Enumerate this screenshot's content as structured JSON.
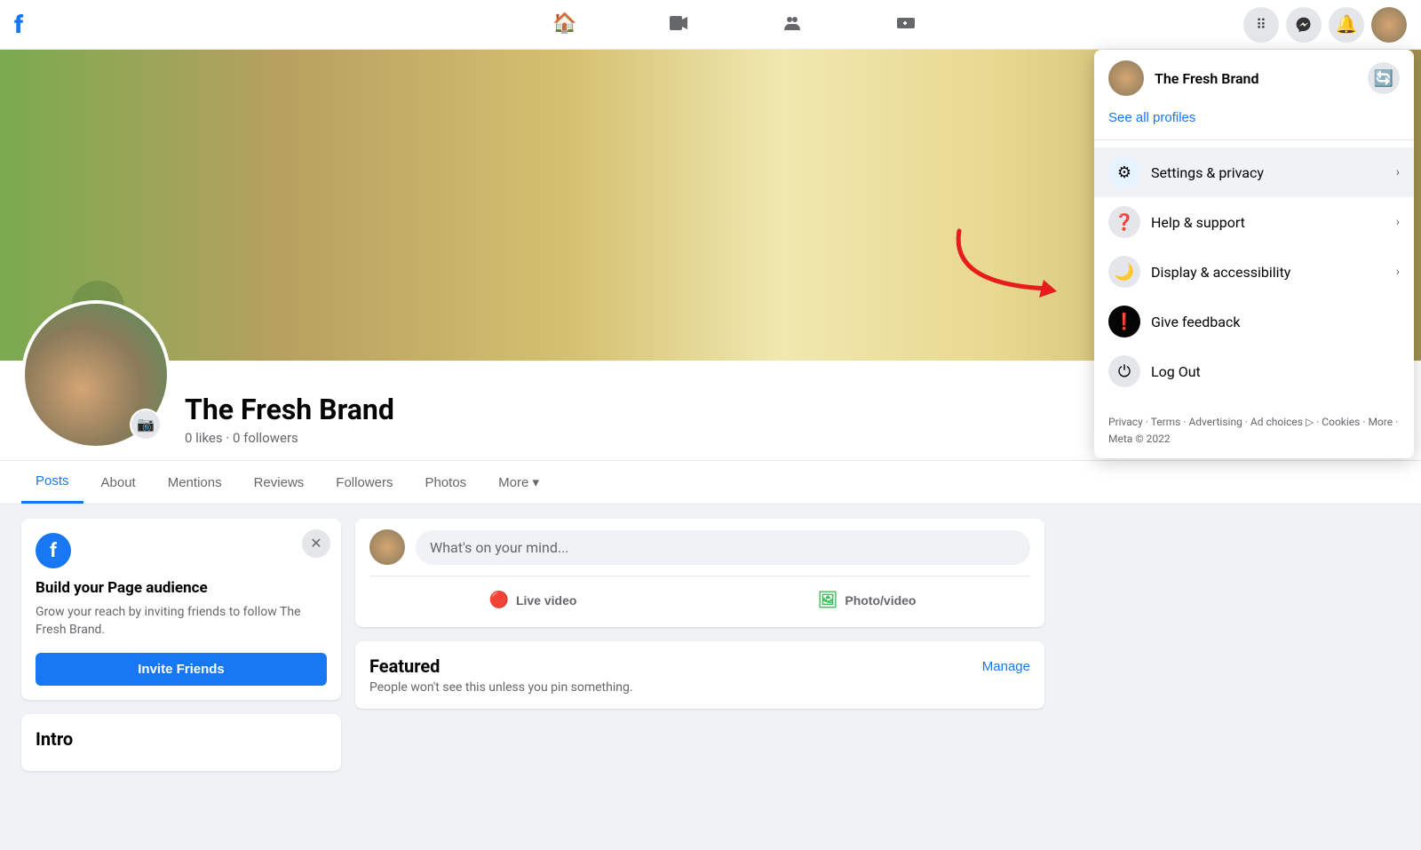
{
  "topnav": {
    "icons": {
      "home": "🏠",
      "video": "▶",
      "groups": "👥",
      "gaming": "🖥",
      "apps": "⠿",
      "messenger": "💬",
      "notifications": "🔔"
    }
  },
  "profile": {
    "name": "The Fresh Brand",
    "likes": "0 likes",
    "followers": "0 followers",
    "stats": "0 likes · 0 followers",
    "avatar_alt": "The Fresh Brand profile picture"
  },
  "tabs": {
    "items": [
      {
        "label": "Posts",
        "active": true
      },
      {
        "label": "About"
      },
      {
        "label": "Mentions"
      },
      {
        "label": "Reviews"
      },
      {
        "label": "Followers"
      },
      {
        "label": "Photos"
      },
      {
        "label": "More ▾"
      }
    ]
  },
  "build_audience_card": {
    "title": "Build your Page audience",
    "description": "Grow your reach by inviting friends to follow The Fresh Brand.",
    "button_label": "Invite Friends"
  },
  "intro": {
    "title": "Intro"
  },
  "post_box": {
    "placeholder": "What's on your mind...",
    "live_label": "Live video",
    "photo_label": "Photo/video"
  },
  "featured_section": {
    "title": "Featured",
    "description": "People won't see this unless you pin something.",
    "manage_label": "Manage"
  },
  "dropdown_menu": {
    "profile_name": "The Fresh Brand",
    "see_all_profiles": "See all profiles",
    "items": [
      {
        "icon": "⚙",
        "label": "Settings & privacy",
        "highlighted": true
      },
      {
        "icon": "❓",
        "label": "Help & support"
      },
      {
        "icon": "🌙",
        "label": "Display & accessibility"
      },
      {
        "icon": "❗",
        "label": "Give feedback"
      },
      {
        "icon": "⏻",
        "label": "Log Out"
      }
    ],
    "footer": "Privacy · Terms · Advertising · Ad choices ▷ · Cookies · More · Meta © 2022"
  }
}
